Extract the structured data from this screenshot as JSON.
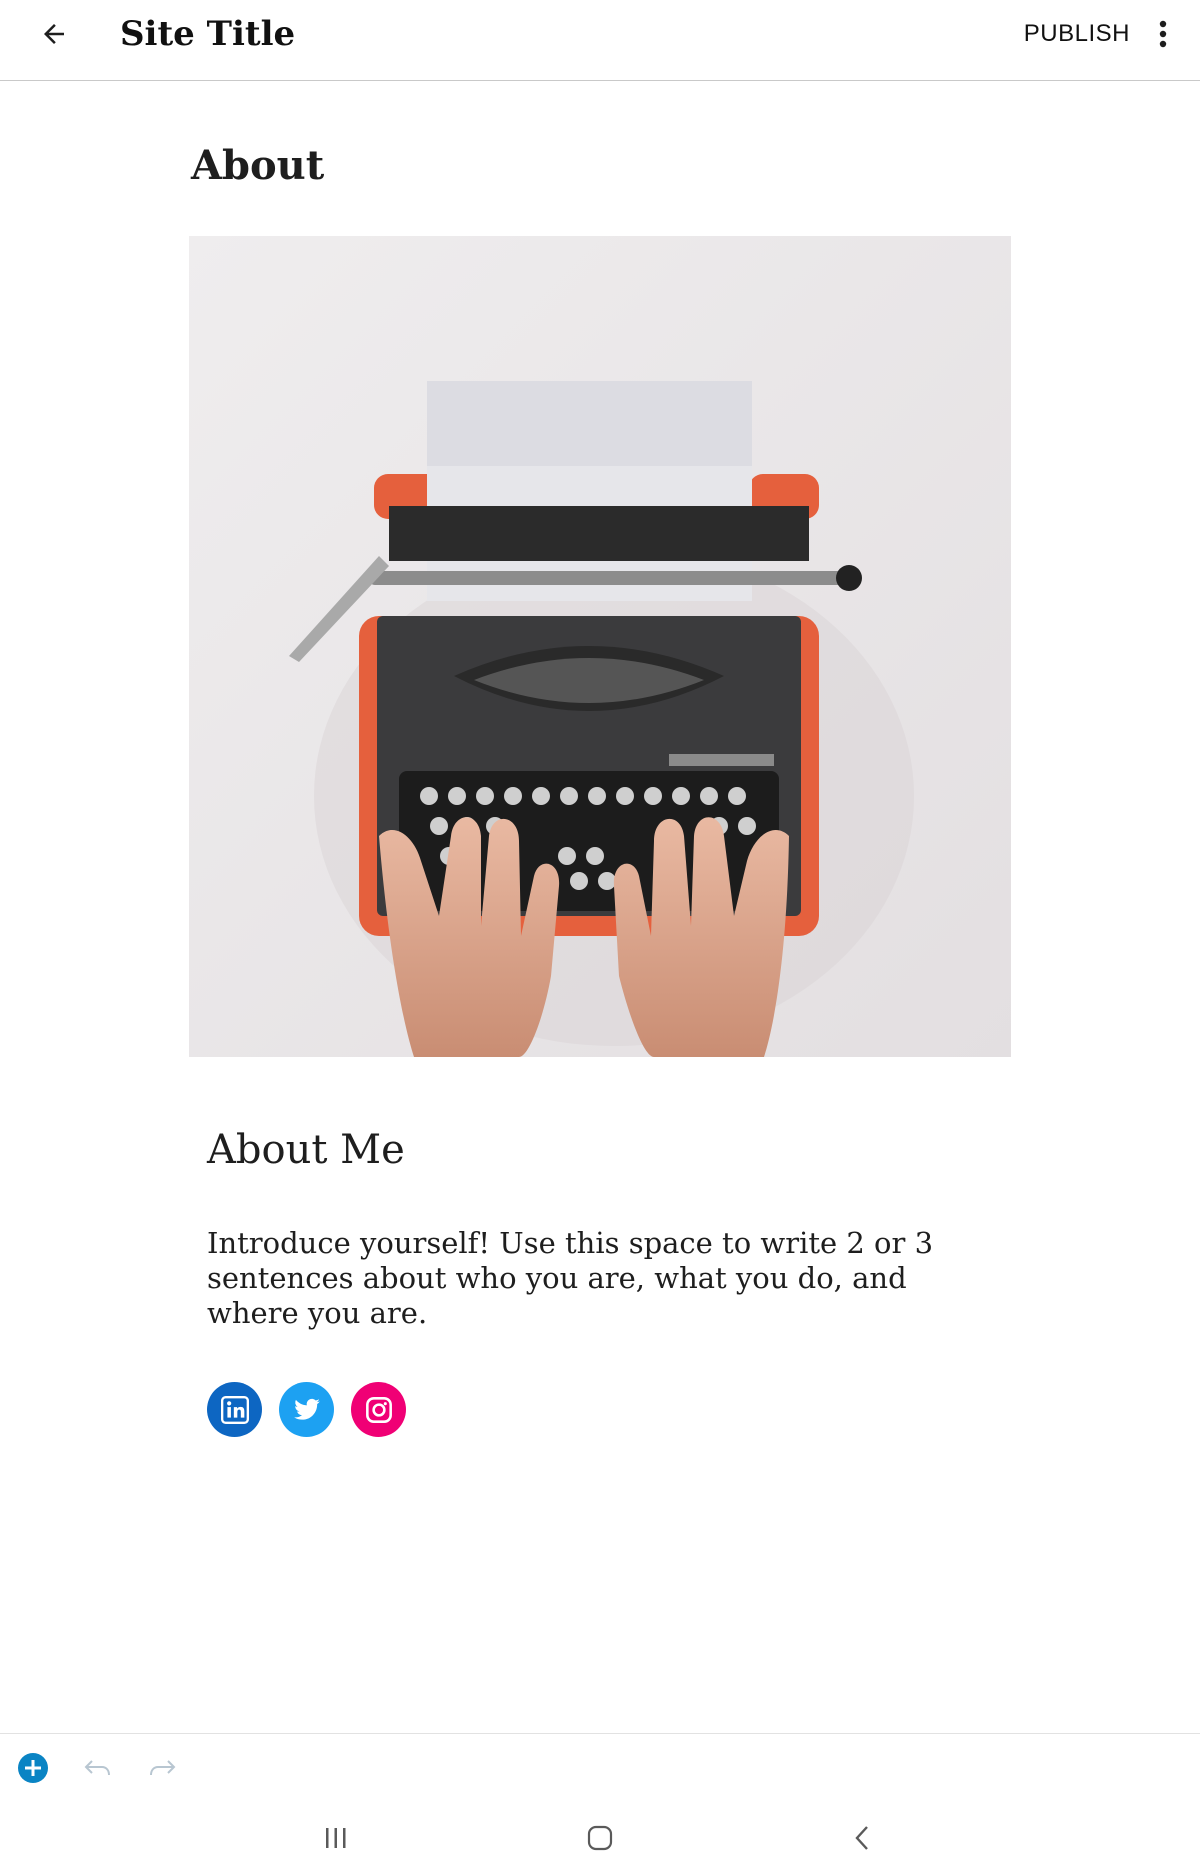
{
  "appbar": {
    "back_icon": "arrow-left-icon",
    "site_title": "Site Title",
    "publish_label": "PUBLISH",
    "more_icon": "more-vertical-icon"
  },
  "content": {
    "page_heading": "About",
    "image": {
      "subject": "typewriter-photo"
    },
    "section_heading": "About Me",
    "intro_text": "Introduce yourself! Use this space to write 2 or 3 sentences about who you are, what you do, and where you are.",
    "social_links": [
      {
        "network": "linkedin",
        "icon": "linkedin-icon",
        "color": "#0d66c2"
      },
      {
        "network": "twitter",
        "icon": "twitter-icon",
        "color": "#1da1f2"
      },
      {
        "network": "instagram",
        "icon": "instagram-icon",
        "color": "#f00075"
      }
    ]
  },
  "toolbar": {
    "add_block_icon": "add-block-icon",
    "undo_icon": "undo-icon",
    "redo_icon": "redo-icon",
    "accent_color": "#0a84c4"
  },
  "navbar": {
    "recents_icon": "recents-icon",
    "home_icon": "home-icon",
    "back_icon": "nav-back-icon"
  }
}
